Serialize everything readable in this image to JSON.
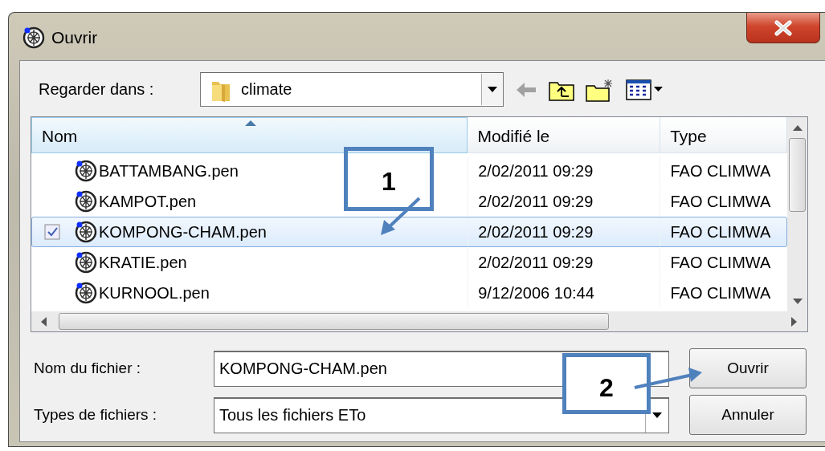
{
  "window": {
    "title": "Ouvrir"
  },
  "look_in": {
    "label": "Regarder dans :",
    "value": "climate"
  },
  "toolbar": [
    {
      "kind": "back",
      "disabled": true
    },
    {
      "kind": "up",
      "disabled": false
    },
    {
      "kind": "new-folder",
      "disabled": false
    },
    {
      "kind": "view-menu",
      "disabled": false
    }
  ],
  "file_list": {
    "columns": [
      {
        "label": "Nom",
        "sorted": true
      },
      {
        "label": "Modifié le",
        "sorted": false
      },
      {
        "label": "Type",
        "sorted": false
      }
    ],
    "rows": [
      {
        "name": "BATTAMBANG.pen",
        "modified": "2/02/2011 09:29",
        "type": "FAO CLIMWA",
        "selected": false
      },
      {
        "name": "KAMPOT.pen",
        "modified": "2/02/2011 09:29",
        "type": "FAO CLIMWA",
        "selected": false
      },
      {
        "name": "KOMPONG-CHAM.pen",
        "modified": "2/02/2011 09:29",
        "type": "FAO CLIMWA",
        "selected": true
      },
      {
        "name": "KRATIE.pen",
        "modified": "2/02/2011 09:29",
        "type": "FAO CLIMWA",
        "selected": false
      },
      {
        "name": "KURNOOL.pen",
        "modified": "9/12/2006 10:44",
        "type": "FAO CLIMWA",
        "selected": false
      }
    ]
  },
  "file_name": {
    "label": "Nom du fichier :",
    "value": "KOMPONG-CHAM.pen"
  },
  "file_type": {
    "label": "Types de fichiers :",
    "value": "Tous les fichiers ETo"
  },
  "buttons": [
    "Ouvrir",
    "Annuler"
  ],
  "callouts": [
    {
      "label": "1"
    },
    {
      "label": "2"
    }
  ]
}
